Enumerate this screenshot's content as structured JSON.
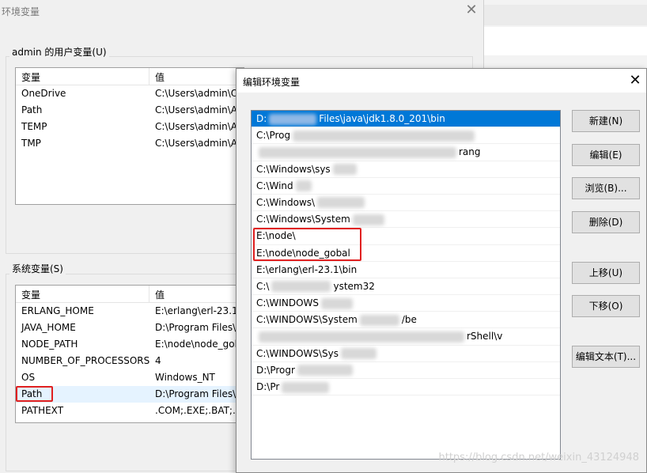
{
  "background_window": {
    "title": "环境变量",
    "user_group_label": "admin 的用户变量(U)",
    "user_table": {
      "headers": [
        "变量",
        "值"
      ],
      "rows": [
        {
          "name": "OneDrive",
          "value": "C:\\Users\\admin\\O"
        },
        {
          "name": "Path",
          "value": "C:\\Users\\admin\\A"
        },
        {
          "name": "TEMP",
          "value": "C:\\Users\\admin\\A"
        },
        {
          "name": "TMP",
          "value": "C:\\Users\\admin\\A"
        }
      ]
    },
    "system_group_label": "系统变量(S)",
    "system_table": {
      "headers": [
        "变量",
        "值"
      ],
      "rows": [
        {
          "name": "ERLANG_HOME",
          "value": "E:\\erlang\\erl-23.1"
        },
        {
          "name": "JAVA_HOME",
          "value": "D:\\Program Files\\"
        },
        {
          "name": "NODE_PATH",
          "value": "E:\\node\\node_gob"
        },
        {
          "name": "NUMBER_OF_PROCESSORS",
          "value": "4"
        },
        {
          "name": "OS",
          "value": "Windows_NT"
        },
        {
          "name": "Path",
          "value": "D:\\Program Files\\"
        },
        {
          "name": "PATHEXT",
          "value": ".COM;.EXE;.BAT;.C"
        }
      ]
    }
  },
  "dialog": {
    "title": "编辑环境变量",
    "path_entries": [
      {
        "prefix": "D:",
        "suffix": "Files\\java\\jdk1.8.0_201\\bin",
        "selected": true
      },
      {
        "prefix": "C:\\Prog",
        "suffix": ""
      },
      {
        "prefix": "",
        "suffix": "rang"
      },
      {
        "prefix": "C:\\Windows\\sys",
        "suffix": ""
      },
      {
        "prefix": "C:\\Wind",
        "suffix": ""
      },
      {
        "prefix": "C:\\Windows\\",
        "suffix": ""
      },
      {
        "prefix": "C:\\Windows\\System",
        "suffix": ""
      },
      {
        "prefix": "E:\\node\\",
        "suffix": ""
      },
      {
        "prefix": "E:\\node\\node_gobal",
        "suffix": ""
      },
      {
        "prefix": "E:\\erlang\\erl-23.1\\bin",
        "suffix": ""
      },
      {
        "prefix": "C:\\",
        "suffix": "ystem32"
      },
      {
        "prefix": "C:\\WINDOWS",
        "suffix": ""
      },
      {
        "prefix": "C:\\WINDOWS\\System",
        "suffix": "/be"
      },
      {
        "prefix": "",
        "suffix": "rShell\\v"
      },
      {
        "prefix": "C:\\WINDOWS\\Sys",
        "suffix": ""
      },
      {
        "prefix": "D:\\Progr",
        "suffix": ""
      },
      {
        "prefix": "D:\\Pr",
        "suffix": ""
      }
    ],
    "buttons": {
      "new": "新建(N)",
      "edit": "编辑(E)",
      "browse": "浏览(B)...",
      "delete": "删除(D)",
      "move_up": "上移(U)",
      "move_down": "下移(O)",
      "edit_text": "编辑文本(T)..."
    }
  },
  "watermark": "https://blog.csdn.net/weixin_43124948",
  "colors": {
    "selection": "#0078d7",
    "highlight_box": "#e02020"
  }
}
